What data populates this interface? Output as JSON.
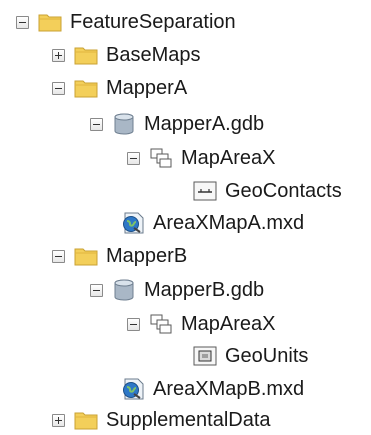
{
  "tree": {
    "items": [
      {
        "label": "FeatureSeparation",
        "icon": "folder-icon",
        "expander": "collapse"
      },
      {
        "label": "BaseMaps",
        "icon": "folder-icon",
        "expander": "expand"
      },
      {
        "label": "MapperA",
        "icon": "folder-icon",
        "expander": "collapse"
      },
      {
        "label": "MapperA.gdb",
        "icon": "geodatabase-icon",
        "expander": "collapse"
      },
      {
        "label": "MapAreaX",
        "icon": "feature-dataset-icon",
        "expander": "collapse"
      },
      {
        "label": "GeoContacts",
        "icon": "line-feature-class-icon",
        "expander": "none"
      },
      {
        "label": "AreaXMapA.mxd",
        "icon": "map-document-icon",
        "expander": "none"
      },
      {
        "label": "MapperB",
        "icon": "folder-icon",
        "expander": "collapse"
      },
      {
        "label": "MapperB.gdb",
        "icon": "geodatabase-icon",
        "expander": "collapse"
      },
      {
        "label": "MapAreaX",
        "icon": "feature-dataset-icon",
        "expander": "collapse"
      },
      {
        "label": "GeoUnits",
        "icon": "polygon-feature-class-icon",
        "expander": "none"
      },
      {
        "label": "AreaXMapB.mxd",
        "icon": "map-document-icon",
        "expander": "none"
      },
      {
        "label": "SupplementalData",
        "icon": "folder-icon",
        "expander": "expand"
      }
    ]
  },
  "colors": {
    "folder": "#f3cf5a",
    "folder_border": "#c9a233",
    "database": "#a9b7c6",
    "globe": "#2e78c7"
  }
}
